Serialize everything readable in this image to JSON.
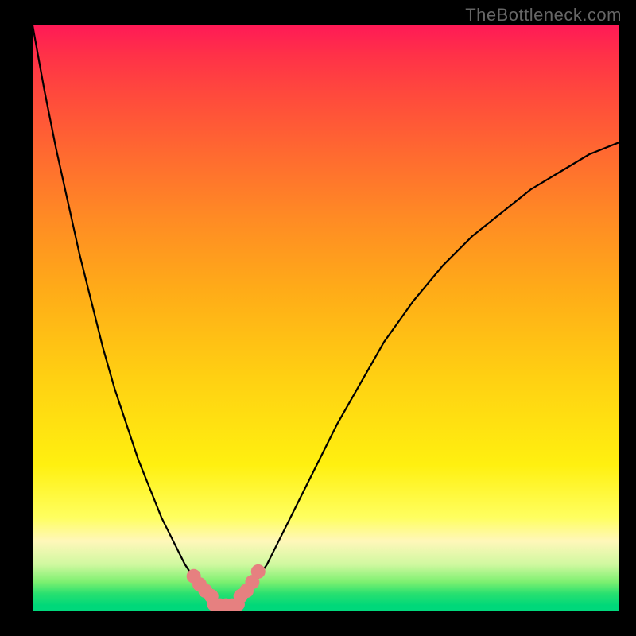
{
  "watermark": "TheBottleneck.com",
  "chart_data": {
    "type": "line",
    "title": "",
    "xlabel": "",
    "ylabel": "",
    "xlim": [
      0,
      1
    ],
    "ylim": [
      0,
      1
    ],
    "gradient_stops": [
      {
        "pos": 0.0,
        "color": "#ff1a56"
      },
      {
        "pos": 0.25,
        "color": "#ff7a28"
      },
      {
        "pos": 0.55,
        "color": "#ffd012"
      },
      {
        "pos": 0.8,
        "color": "#ffff40"
      },
      {
        "pos": 0.92,
        "color": "#b0f880"
      },
      {
        "pos": 1.0,
        "color": "#00d87c"
      }
    ],
    "series": [
      {
        "name": "curve",
        "color": "#000000",
        "x": [
          0.0,
          0.02,
          0.04,
          0.06,
          0.08,
          0.1,
          0.12,
          0.14,
          0.16,
          0.18,
          0.2,
          0.22,
          0.24,
          0.26,
          0.28,
          0.3,
          0.31,
          0.32,
          0.33,
          0.34,
          0.35,
          0.36,
          0.38,
          0.4,
          0.42,
          0.44,
          0.48,
          0.52,
          0.56,
          0.6,
          0.65,
          0.7,
          0.75,
          0.8,
          0.85,
          0.9,
          0.95,
          1.0
        ],
        "y": [
          1.0,
          0.89,
          0.79,
          0.7,
          0.61,
          0.53,
          0.45,
          0.38,
          0.32,
          0.26,
          0.21,
          0.16,
          0.12,
          0.08,
          0.05,
          0.03,
          0.02,
          0.015,
          0.01,
          0.015,
          0.02,
          0.03,
          0.05,
          0.08,
          0.12,
          0.16,
          0.24,
          0.32,
          0.39,
          0.46,
          0.53,
          0.59,
          0.64,
          0.68,
          0.72,
          0.75,
          0.78,
          0.8
        ]
      },
      {
        "name": "highlight-dots",
        "color": "#e68080",
        "x": [
          0.275,
          0.285,
          0.295,
          0.305,
          0.31,
          0.32,
          0.33,
          0.34,
          0.35,
          0.355,
          0.365,
          0.375,
          0.385
        ],
        "y": [
          0.06,
          0.046,
          0.035,
          0.026,
          0.012,
          0.01,
          0.01,
          0.01,
          0.012,
          0.026,
          0.035,
          0.05,
          0.068
        ]
      }
    ]
  }
}
